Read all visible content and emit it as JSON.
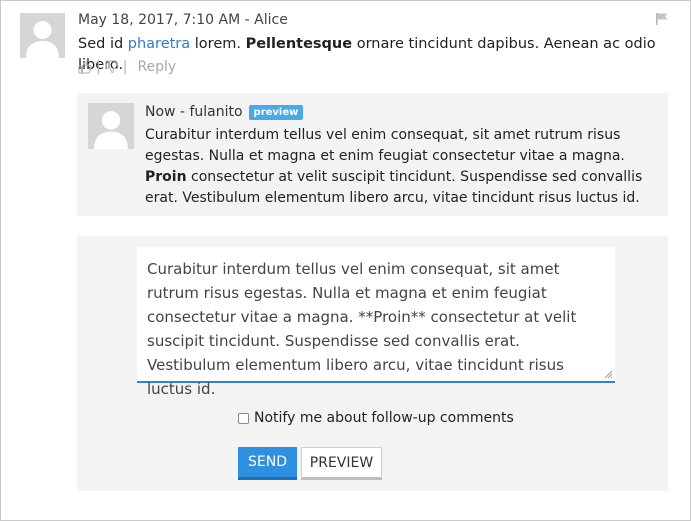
{
  "comment": {
    "meta": "May 18, 2017, 7:10 AM - Alice",
    "text": {
      "part1": "Sed id ",
      "link": "pharetra",
      "part2": " lorem. ",
      "bold": "Pellentesque",
      "part3": " ornare tincidunt dapibus. Aenean ac odio libero."
    },
    "actions": {
      "separator": "|",
      "reply_label": "Reply"
    }
  },
  "preview_reply": {
    "meta": "Now - fulanito",
    "badge": "preview",
    "text": {
      "part1": "Curabitur interdum tellus vel enim consequat, sit amet rutrum risus egestas. Nulla et magna et enim feugiat consectetur vitae a magna. ",
      "bold": "Proin",
      "part2": " consectetur at velit suscipit tincidunt. Suspendisse sed convallis erat. Vestibulum elementum libero arcu, vitae tincidunt risus luctus id."
    }
  },
  "compose": {
    "textarea_value": "Curabitur interdum tellus vel enim consequat, sit amet rutrum risus egestas. Nulla et magna et enim feugiat consectetur vitae a magna. **Proin** consectetur at velit suscipit tincidunt. Suspendisse sed convallis erat. Vestibulum elementum libero arcu, vitae tincidunt risus luctus id.",
    "notify_label": "Notify me about follow-up comments",
    "notify_checked": false,
    "send_label": "SEND",
    "preview_label": "PREVIEW"
  },
  "colors": {
    "link": "#2e7bcf",
    "badge": "#4aaae8",
    "send_button": "#2f8fe0",
    "textarea_focus": "#2f80d6"
  },
  "icons": [
    "avatar-placeholder",
    "flag-icon",
    "thumbs-up-icon",
    "thumbs-down-icon",
    "resize-handle-icon"
  ]
}
